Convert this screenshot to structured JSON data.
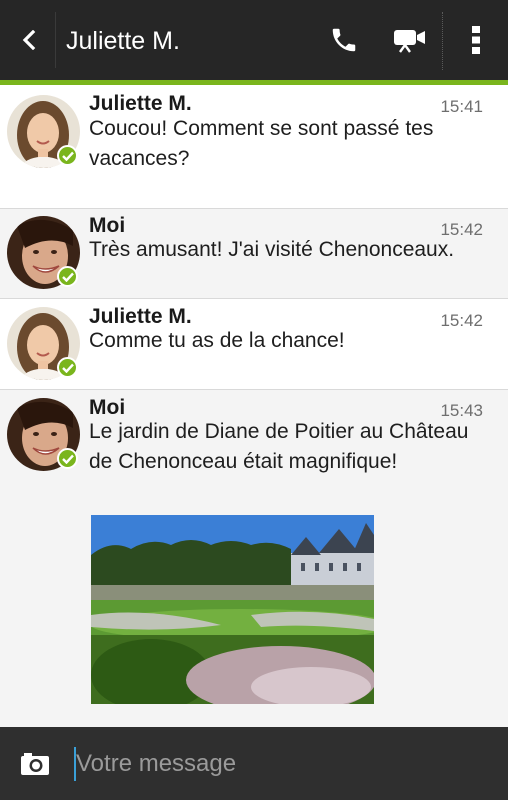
{
  "header": {
    "title": "Juliette M.",
    "back_icon": "back-arrow-icon",
    "call_icon": "phone-icon",
    "video_icon": "video-camera-icon",
    "menu_icon": "overflow-menu-icon"
  },
  "colors": {
    "header_bg": "#262626",
    "accent": "#7ab51d",
    "composer_bg": "#2f2f2f",
    "cursor": "#3aa0d8"
  },
  "messages": [
    {
      "sender": "Juliette M.",
      "time": "15:41",
      "text": "Coucou! Comment se sont passé tes vacances?",
      "status_icon": "delivered-check-icon"
    },
    {
      "sender": "Moi",
      "time": "15:42",
      "text": "Très amusant! J'ai visité Chenonceaux.",
      "status_icon": "delivered-check-icon"
    },
    {
      "sender": "Juliette M.",
      "time": "15:42",
      "text": "Comme tu as de la chance!",
      "status_icon": "delivered-check-icon"
    },
    {
      "sender": "Moi",
      "time": "15:43",
      "text": "Le jardin de Diane de Poitier au Château de Chenonceau était magnifique!",
      "status_icon": "delivered-check-icon",
      "attachment": "garden-chateau-photo"
    }
  ],
  "composer": {
    "placeholder": "Votre message",
    "camera_icon": "camera-icon"
  }
}
